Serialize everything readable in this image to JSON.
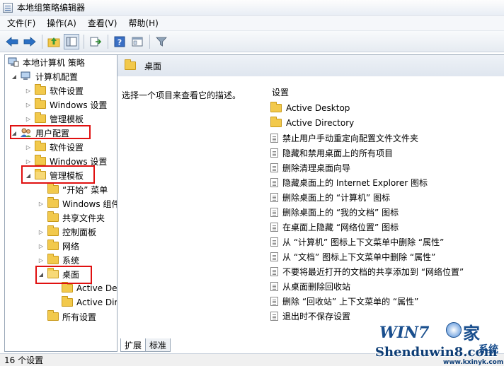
{
  "window": {
    "title": "本地组策略编辑器"
  },
  "menu": {
    "items": [
      "文件(F)",
      "操作(A)",
      "查看(V)",
      "帮助(H)"
    ]
  },
  "tree": {
    "items": [
      {
        "label": "本地计算机 策略",
        "icon": "computer-policy-icon"
      },
      {
        "label": "计算机配置",
        "icon": "computer-icon"
      },
      {
        "label": "软件设置",
        "icon": "folder-icon"
      },
      {
        "label": "Windows 设置",
        "icon": "folder-icon"
      },
      {
        "label": "管理模板",
        "icon": "folder-icon"
      },
      {
        "label": "用户配置",
        "icon": "user-icon"
      },
      {
        "label": "软件设置",
        "icon": "folder-icon"
      },
      {
        "label": "Windows 设置",
        "icon": "folder-icon"
      },
      {
        "label": "管理模板",
        "icon": "folder-icon"
      },
      {
        "label": "“开始” 菜单",
        "icon": "folder-icon"
      },
      {
        "label": "Windows 组件",
        "icon": "folder-icon"
      },
      {
        "label": "共享文件夹",
        "icon": "folder-icon"
      },
      {
        "label": "控制面板",
        "icon": "folder-icon"
      },
      {
        "label": "网络",
        "icon": "folder-icon"
      },
      {
        "label": "系统",
        "icon": "folder-icon"
      },
      {
        "label": "桌面",
        "icon": "folder-open-icon"
      },
      {
        "label": "Active Desktop",
        "icon": "folder-icon"
      },
      {
        "label": "Active Directory",
        "icon": "folder-icon"
      },
      {
        "label": "所有设置",
        "icon": "folder-icon"
      }
    ]
  },
  "right": {
    "header": "桌面",
    "description": "选择一个项目来查看它的描述。",
    "column_header": "设置",
    "items": [
      {
        "label": "Active Desktop",
        "icon": "folder-icon"
      },
      {
        "label": "Active Directory",
        "icon": "folder-icon"
      },
      {
        "label": "禁止用户手动重定向配置文件文件夹",
        "icon": "setting-icon"
      },
      {
        "label": "隐藏和禁用桌面上的所有项目",
        "icon": "setting-icon"
      },
      {
        "label": "删除清理桌面向导",
        "icon": "setting-icon"
      },
      {
        "label": "隐藏桌面上的 Internet Explorer 图标",
        "icon": "setting-icon"
      },
      {
        "label": "删除桌面上的 “计算机” 图标",
        "icon": "setting-icon"
      },
      {
        "label": "删除桌面上的 “我的文档” 图标",
        "icon": "setting-icon"
      },
      {
        "label": "在桌面上隐藏 “网络位置” 图标",
        "icon": "setting-icon"
      },
      {
        "label": "从 “计算机” 图标上下文菜单中删除 “属性”",
        "icon": "setting-icon"
      },
      {
        "label": "从 “文档” 图标上下文菜单中删除 “属性”",
        "icon": "setting-icon"
      },
      {
        "label": "不要将最近打开的文档的共享添加到 “网络位置”",
        "icon": "setting-icon"
      },
      {
        "label": "从桌面删除回收站",
        "icon": "setting-icon"
      },
      {
        "label": "删除 “回收站” 上下文菜单的 “属性”",
        "icon": "setting-icon"
      },
      {
        "label": "退出时不保存设置",
        "icon": "setting-icon"
      }
    ]
  },
  "tabs": [
    "扩展",
    "标准"
  ],
  "status": {
    "text": "16 个设置"
  },
  "watermark": {
    "main": "WIN7",
    "jia": "家",
    "sub": "Shenduwin8.com",
    "aijia": "系统",
    "url": "www.kxinyk.com"
  },
  "colors": {
    "highlight_box": "#e01010",
    "folder": "#f2c94c",
    "header_bg": "#dfe6ef"
  }
}
